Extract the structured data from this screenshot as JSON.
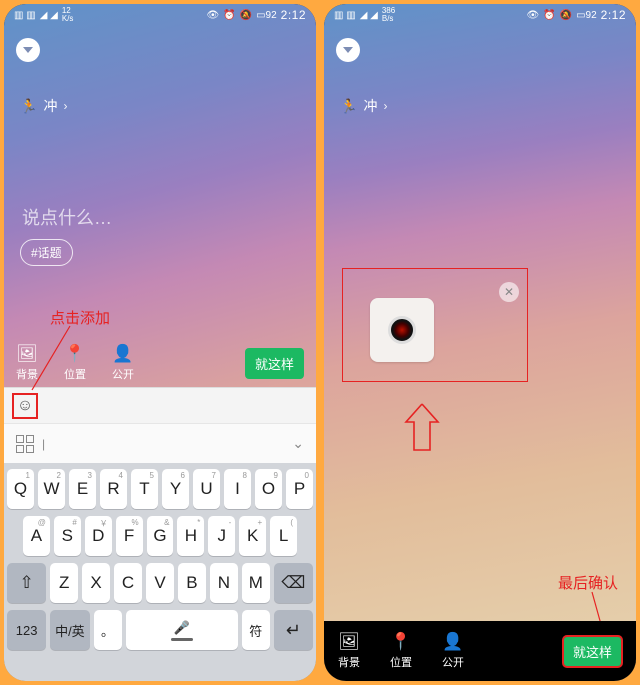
{
  "status": {
    "net_rate_left": "12\nK/s",
    "net_rate_right": "386\nB/s",
    "battery": "92",
    "time": "2:12"
  },
  "post": {
    "tag": "冲",
    "placeholder": "说点什么…",
    "topic_chip": "#话题"
  },
  "actions": {
    "bg": "背景",
    "loc": "位置",
    "vis": "公开",
    "confirm": "就这样"
  },
  "annotations": {
    "add_click": "点击添加",
    "final_confirm": "最后确认"
  },
  "keyboard": {
    "r1": [
      {
        "k": "Q",
        "n": "1"
      },
      {
        "k": "W",
        "n": "2"
      },
      {
        "k": "E",
        "n": "3"
      },
      {
        "k": "R",
        "n": "4"
      },
      {
        "k": "T",
        "n": "5"
      },
      {
        "k": "Y",
        "n": "6"
      },
      {
        "k": "U",
        "n": "7"
      },
      {
        "k": "I",
        "n": "8"
      },
      {
        "k": "O",
        "n": "9"
      },
      {
        "k": "P",
        "n": "0"
      }
    ],
    "r2": [
      {
        "k": "A",
        "n": "@"
      },
      {
        "k": "S",
        "n": "#"
      },
      {
        "k": "D",
        "n": "￥"
      },
      {
        "k": "F",
        "n": "%"
      },
      {
        "k": "G",
        "n": "&"
      },
      {
        "k": "H",
        "n": "*"
      },
      {
        "k": "J",
        "n": "-"
      },
      {
        "k": "K",
        "n": "+"
      },
      {
        "k": "L",
        "n": "("
      }
    ],
    "r3": [
      {
        "k": "Z",
        "n": ""
      },
      {
        "k": "X",
        "n": ""
      },
      {
        "k": "C",
        "n": ""
      },
      {
        "k": "V",
        "n": ""
      },
      {
        "k": "B",
        "n": ""
      },
      {
        "k": "N",
        "n": ""
      },
      {
        "k": "M",
        "n": ""
      }
    ],
    "num_key": "123",
    "lang_key": "中/英",
    "period_key": "。",
    "sym_key": "符",
    "enter_key": "↵"
  }
}
